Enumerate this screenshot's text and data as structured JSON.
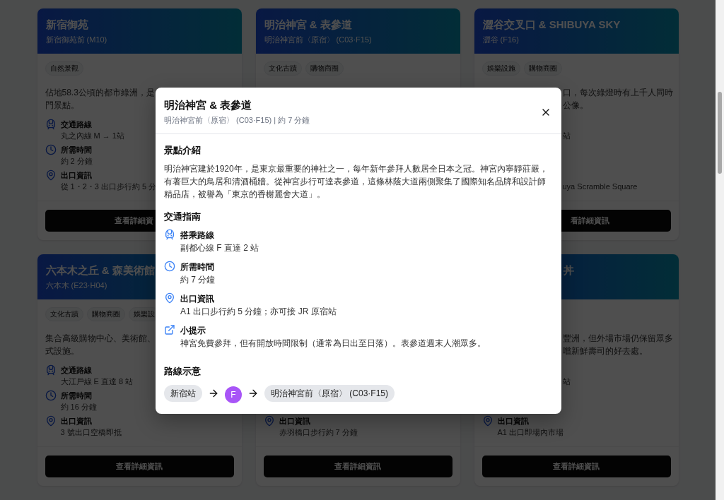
{
  "cards": [
    {
      "title": "新宿御苑",
      "subtitle": "新宿御苑前 (M10)",
      "tags": [
        "自然景觀"
      ],
      "description": [
        "佔地58.3公頃的都市綠洲，是",
        "門景點。"
      ],
      "details": {
        "route": {
          "label": "交通路線",
          "value": "丸之內線 M → 1站"
        },
        "time": {
          "label": "所需時間",
          "value": "約 2 分鐘"
        },
        "exit": {
          "label": "出口資訊",
          "value": "從 1・2・3 出口步行約 5 分"
        }
      },
      "button": "查看詳細資"
    },
    {
      "title": "明治神宮 & 表參道",
      "subtitle": "明治神宮前〈原宿〉 (C03·F15)",
      "tags": [
        "文化古蹟",
        "購物商圈"
      ]
    },
    {
      "title": "澀谷交叉口 & SHIBUYA SKY",
      "subtitle": "澀谷 (F16)",
      "tags": [
        "娛樂設施",
        "購物商圈"
      ],
      "description": [
        "口，每次綠燈時有上千人同時",
        "公像。"
      ],
      "details": {
        "route": {
          "value": "站"
        },
        "exit": {
          "value": "uya Scramble Square"
        }
      },
      "button": "看詳細資訊"
    },
    {
      "title": "六本木之丘 & 森美術館",
      "subtitle": "六本木 (E23·H04)",
      "tags": [
        "文化古蹟",
        "購物商圈",
        "娛樂設"
      ],
      "description": [
        "集合高級購物中心、美術館、",
        "式設施。"
      ],
      "details": {
        "route": {
          "label": "交通路線",
          "value": "大江戶線 E 直達 8 站"
        },
        "time": {
          "label": "所需時間",
          "value": "約 16 分鐘"
        },
        "exit": {
          "label": "出口資訊",
          "value": "3 號出口空橋即抵"
        }
      },
      "button": "查看詳細資訊"
    },
    {
      "details": {
        "exit": {
          "label": "出口資訊",
          "value": "赤羽橋口步行約 7 分鐘"
        }
      },
      "button": "查看詳細資訊"
    },
    {
      "title": "丼",
      "description": [
        "豐洲，但外場市場仍保留眾多",
        "嚐新鮮壽司的好去處。"
      ],
      "details": {
        "route": {
          "value": "站"
        },
        "exit": {
          "label": "出口資訊",
          "value": "A1 出口即場內市場"
        }
      },
      "button": "查看詳細資訊"
    }
  ],
  "modal": {
    "title": "明治神宮 & 表參道",
    "subtitle": "明治神宮前〈原宿〉 (C03·F15) | 約 7 分鐘",
    "intro": {
      "heading": "景點介紹",
      "text": "明治神宮建於1920年，是東京最重要的神社之一，每年新年參拜人數居全日本之冠。神宮內寧靜莊嚴，有著巨大的鳥居和清酒桶牆。從神宮步行可達表參道，這條林蔭大道兩側聚集了國際知名品牌和設計師精品店，被譽為「東京的香榭麗舍大道」。"
    },
    "transit": {
      "heading": "交通指南",
      "items": [
        {
          "kind": "route",
          "label": "搭乘路線",
          "value": "副都心線 F 直達 2 站"
        },
        {
          "kind": "time",
          "label": "所需時間",
          "value": "約 7 分鐘"
        },
        {
          "kind": "exit",
          "label": "出口資訊",
          "value": "A1 出口步行約 5 分鐘；亦可接 JR 原宿站"
        },
        {
          "kind": "tip",
          "label": "小提示",
          "value": "神宮免費參拜，但有開放時間限制（通常為日出至日落）。表參道週末人潮眾多。"
        }
      ]
    },
    "route_map": {
      "heading": "路線示意",
      "steps": [
        {
          "kind": "station",
          "label": "新宿站"
        },
        {
          "kind": "line",
          "label": "F",
          "color": "#a855f7"
        },
        {
          "kind": "station",
          "label": "明治神宮前〈原宿〉 (C03·F15)"
        }
      ]
    }
  }
}
